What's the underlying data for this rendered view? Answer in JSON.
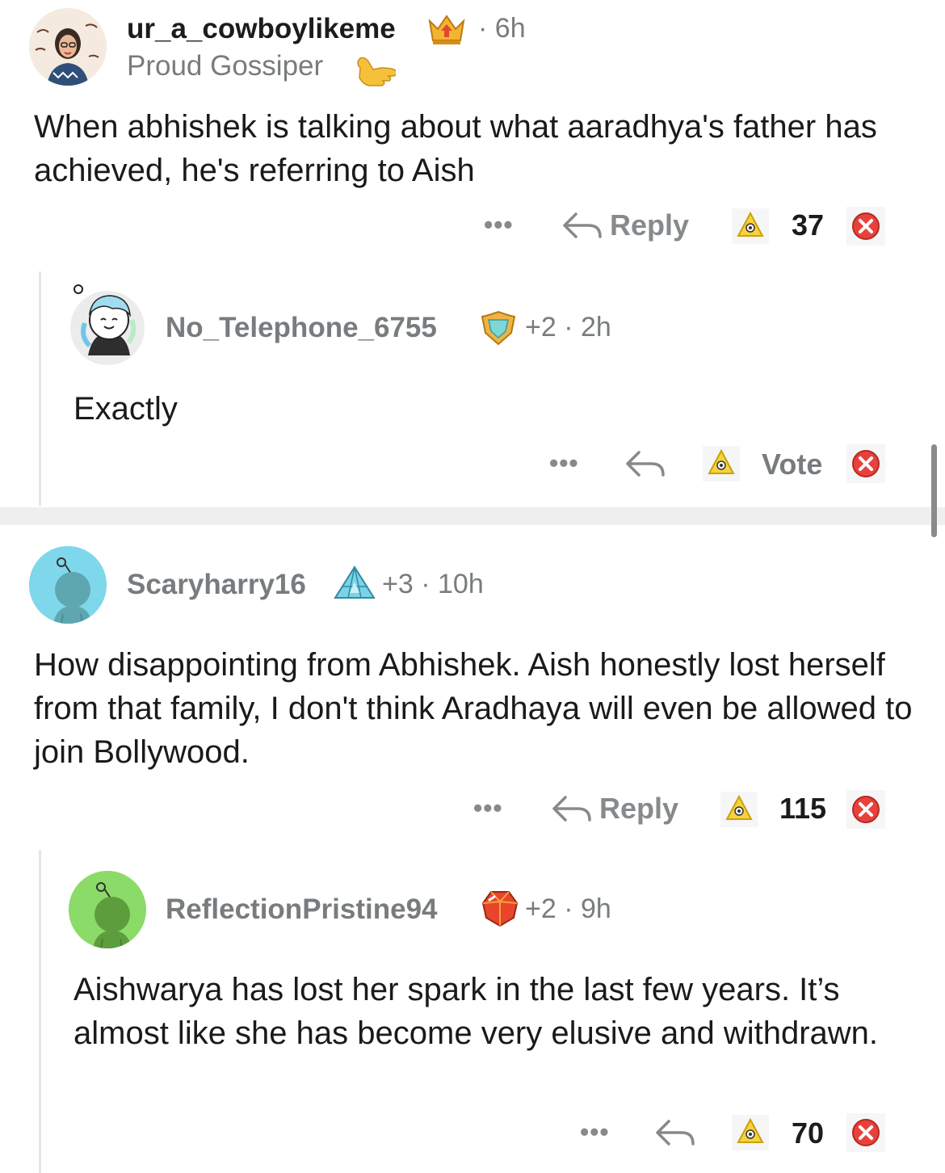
{
  "comments": [
    {
      "username": "ur_a_cowboylikeme",
      "award_icon": "crown-award-icon",
      "time": "6h",
      "flair_text": "Proud Gossiper",
      "flair_icon": "call-me-hand-icon",
      "body": "When abhishek is talking about what aaradhya's father has achieved, he's referring to Aish",
      "reply_label": "Reply",
      "votes": "37"
    },
    {
      "username": "No_Telephone_6755",
      "award_icon": "shield-award-icon",
      "award_count": "+2",
      "time": "2h",
      "body": "Exactly",
      "votes": "Vote"
    },
    {
      "username": "Scaryharry16",
      "award_icon": "diamond-award-icon",
      "award_count": "+3",
      "time": "10h",
      "body": "How disappointing from Abhishek. Aish honestly lost herself from that family, I don't think Aradhaya will even be allowed to join Bollywood.",
      "reply_label": "Reply",
      "votes": "115"
    },
    {
      "username": "ReflectionPristine94",
      "award_icon": "gem-award-icon",
      "award_count": "+2",
      "time": "9h",
      "body": "Aishwarya has lost her spark in the last few years. It’s almost like she has become very elusive and withdrawn.",
      "votes": "70"
    }
  ],
  "common": {
    "separator": "·",
    "more_dots": "•••"
  },
  "colors": {
    "meta_grey": "#787c7e",
    "action_grey": "#878a8c",
    "downvote_red": "#e8413b",
    "upvote_gold": "#f0c020",
    "divider": "#efefef"
  }
}
